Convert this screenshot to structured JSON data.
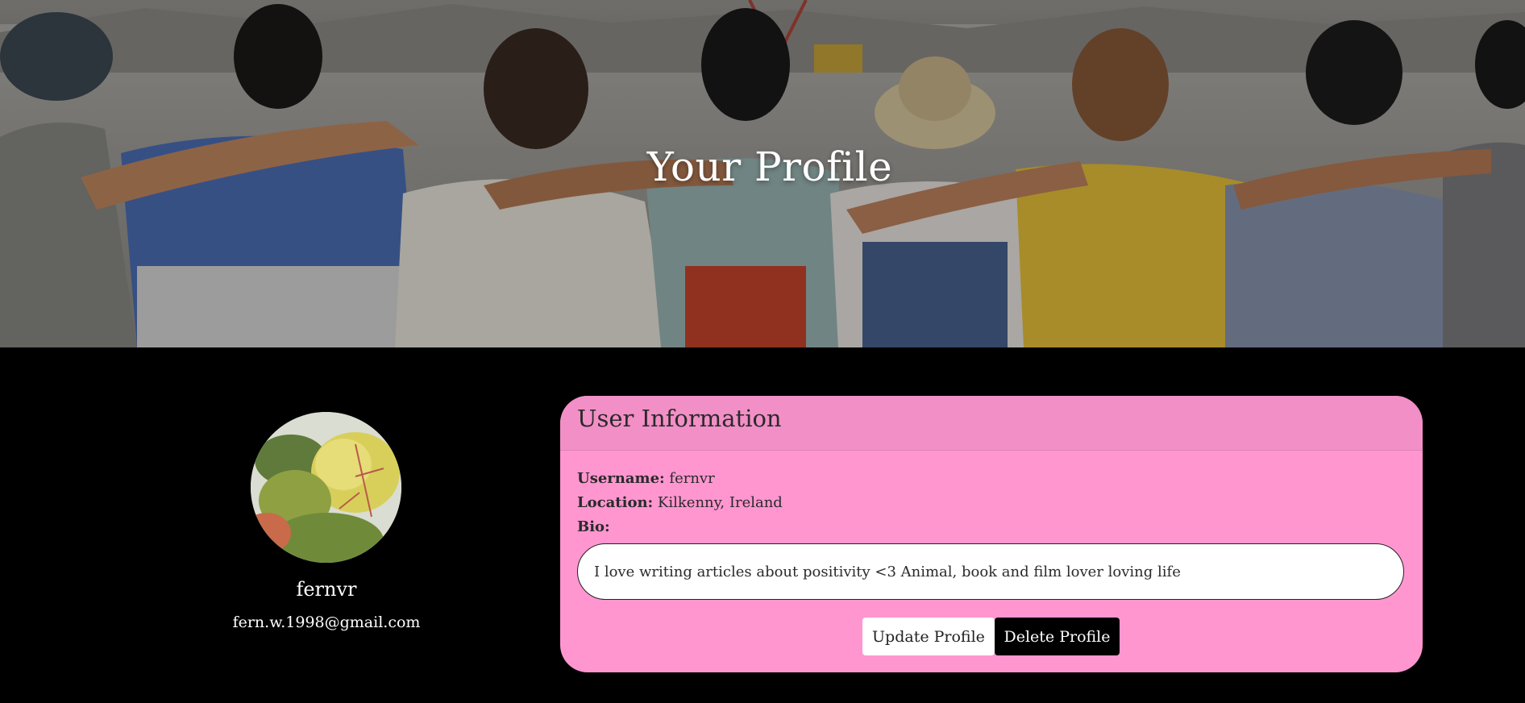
{
  "hero": {
    "title": "Your Profile",
    "image": "group-of-friends-arms-around-shoulders-photo"
  },
  "profile": {
    "avatar": "leaf-plant-photo",
    "username": "fernvr",
    "email": "fern.w.1998@gmail.com"
  },
  "user_info": {
    "title": "User Information",
    "username_label": "Username:",
    "username_value": "fernvr",
    "location_label": "Location:",
    "location_value": "Kilkenny, Ireland",
    "bio_label": "Bio:",
    "bio_value": "I love writing articles about positivity <3 Animal, book and film lover loving life"
  },
  "actions": {
    "update_label": "Update Profile",
    "delete_label": "Delete Profile"
  },
  "colors": {
    "page_background": "#000000",
    "card_background": "#ff96d0",
    "card_header": "#f28fc6",
    "update_button": "#ffffff",
    "delete_button": "#000000"
  }
}
